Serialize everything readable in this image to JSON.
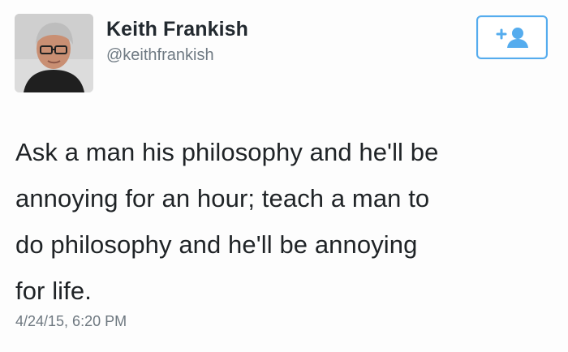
{
  "tweet": {
    "author": {
      "display_name": "Keith Frankish",
      "username": "@keithfrankish",
      "avatar_icon": "profile-photo-avatar"
    },
    "follow_button": {
      "icon": "follow-user-plus-icon",
      "accent_color": "#55acee"
    },
    "text": "Ask a man his philosophy and he'll be\nannoying for an hour; teach a man to\ndo philosophy and he'll be annoying\nfor life.",
    "timestamp": "4/24/15, 6:20 PM"
  }
}
